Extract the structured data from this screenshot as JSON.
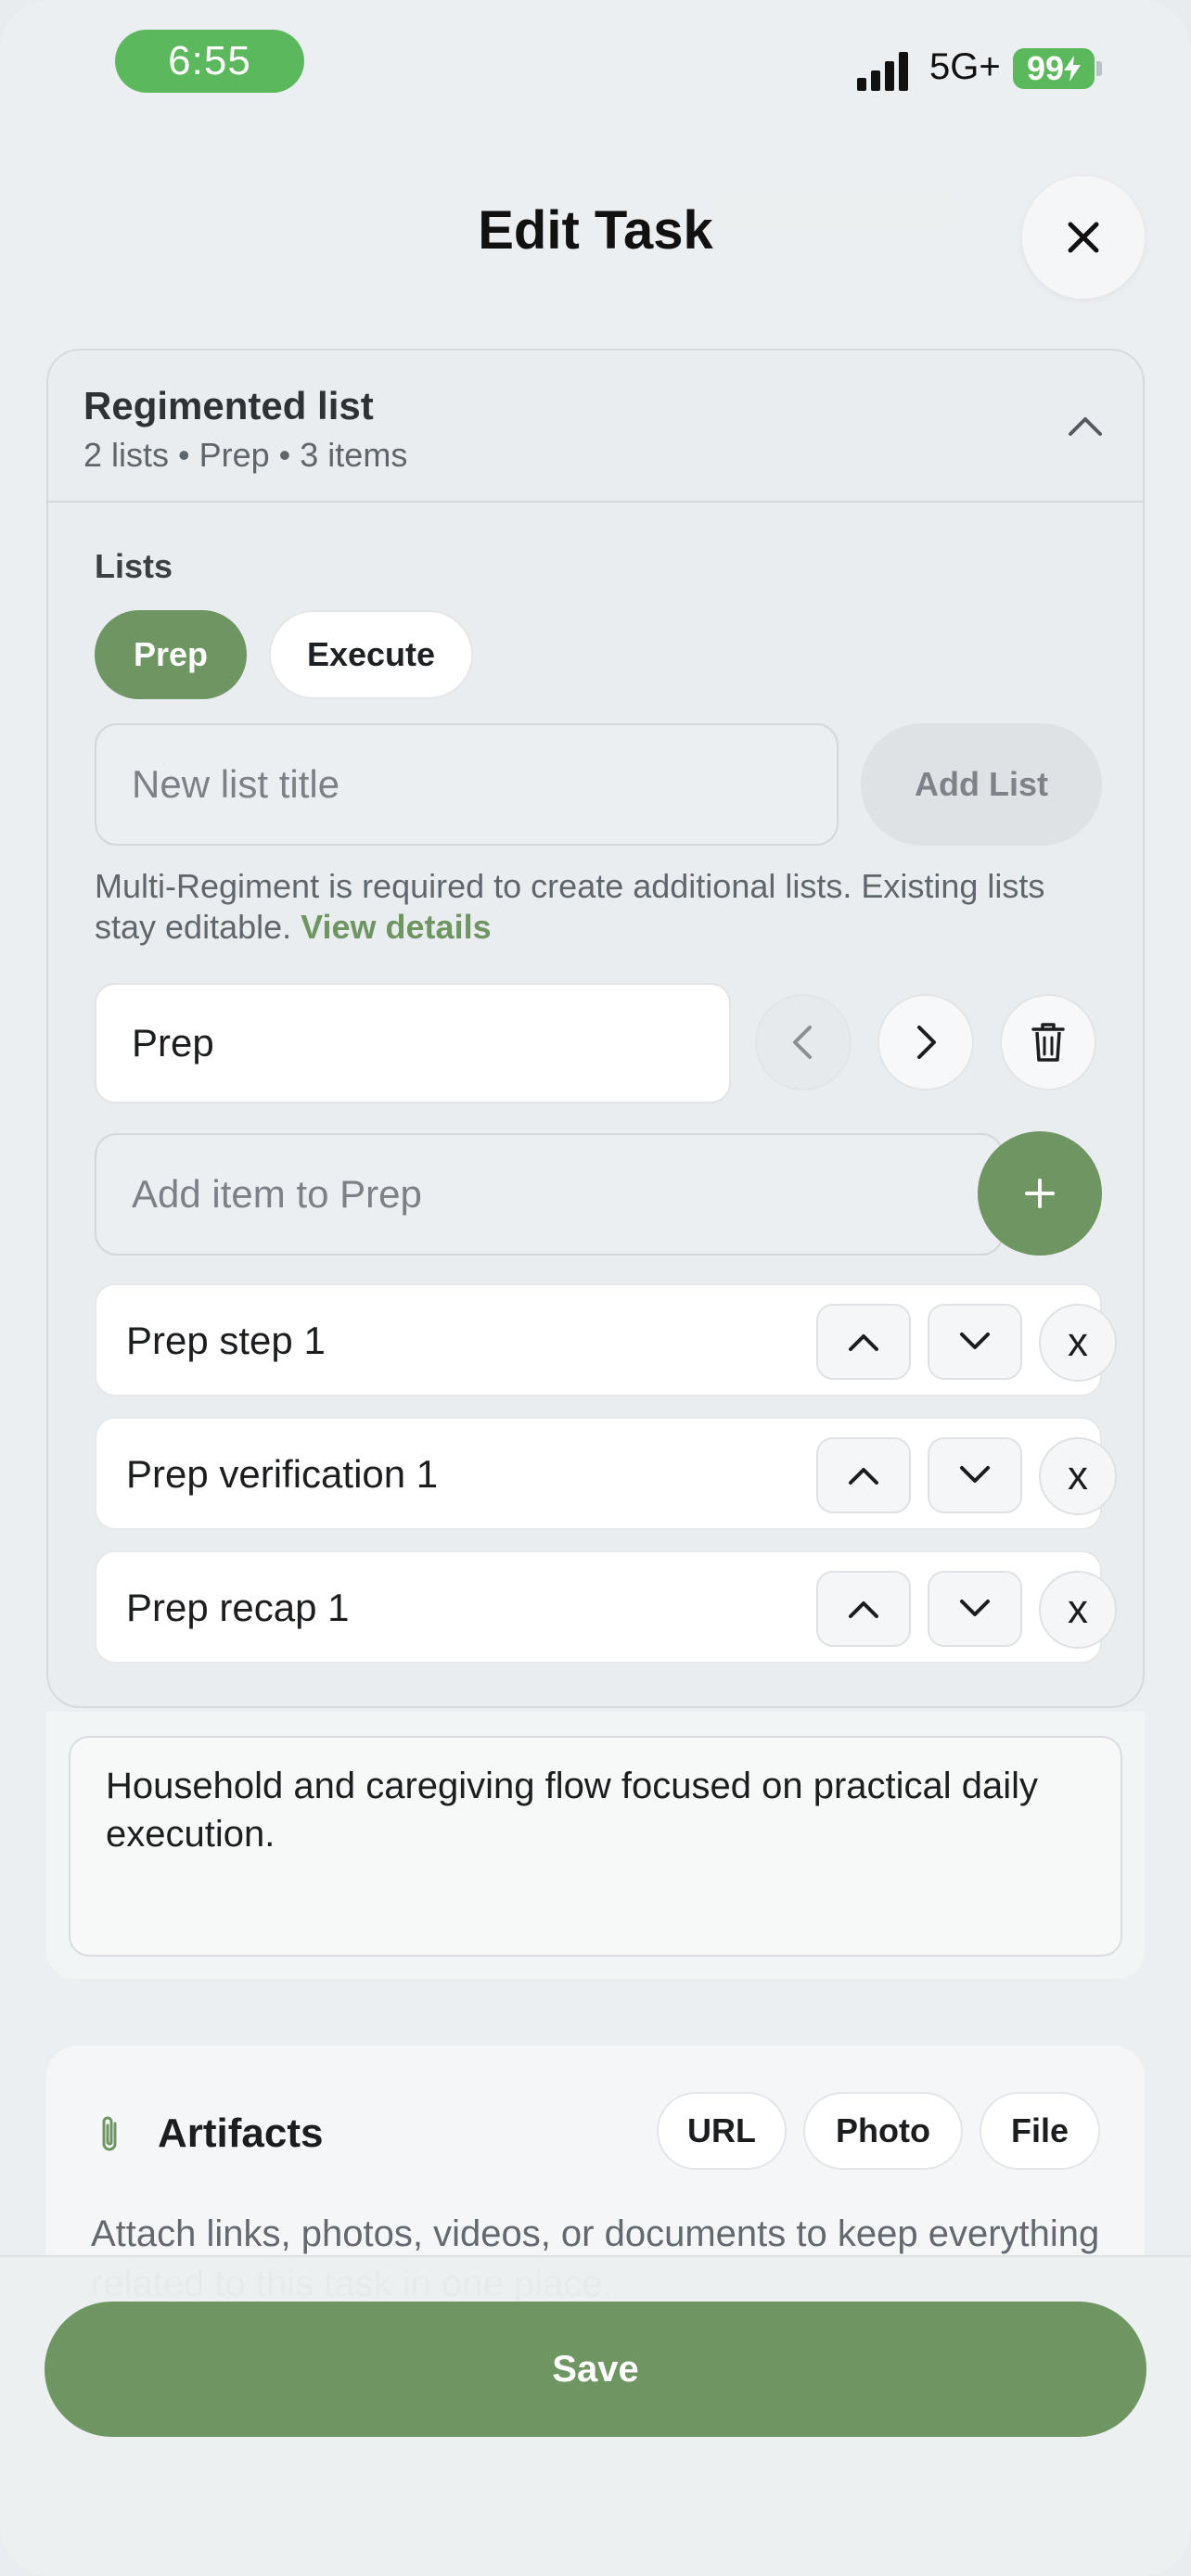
{
  "status_bar": {
    "time": "6:55",
    "network": "5G+",
    "battery": "99"
  },
  "header": {
    "title": "Edit Task"
  },
  "regimented": {
    "title": "Regimented list",
    "subtitle": "2 lists • Prep • 3 items",
    "lists_label": "Lists",
    "chips": [
      {
        "label": "Prep",
        "selected": true
      },
      {
        "label": "Execute",
        "selected": false
      }
    ],
    "new_list_placeholder": "New list title",
    "add_list_label": "Add List",
    "notice_text": "Multi-Regiment is required to create additional lists. Existing lists stay editable.",
    "notice_link": "View details",
    "current_list_name": "Prep",
    "add_item_placeholder": "Add item to Prep",
    "items": [
      {
        "label": "Prep step 1"
      },
      {
        "label": "Prep verification 1"
      },
      {
        "label": "Prep recap 1"
      }
    ],
    "remove_label": "x"
  },
  "description": {
    "text": "Household and caregiving flow focused on practical daily execution."
  },
  "artifacts": {
    "title": "Artifacts",
    "buttons": [
      "URL",
      "Photo",
      "File"
    ],
    "description": "Attach links, photos, videos, or documents to keep everything related to this task in one place."
  },
  "footer": {
    "save_label": "Save"
  },
  "colors": {
    "accent": "#6f9563",
    "status_green": "#5cb85c"
  },
  "icons": {
    "close": "close-icon",
    "collapse": "chevron-up-icon",
    "prev": "chevron-left-icon",
    "next": "chevron-right-icon",
    "delete": "trash-icon",
    "add": "plus-icon",
    "move_up": "chevron-up-icon",
    "move_down": "chevron-down-icon",
    "attachment": "paperclip-icon"
  }
}
